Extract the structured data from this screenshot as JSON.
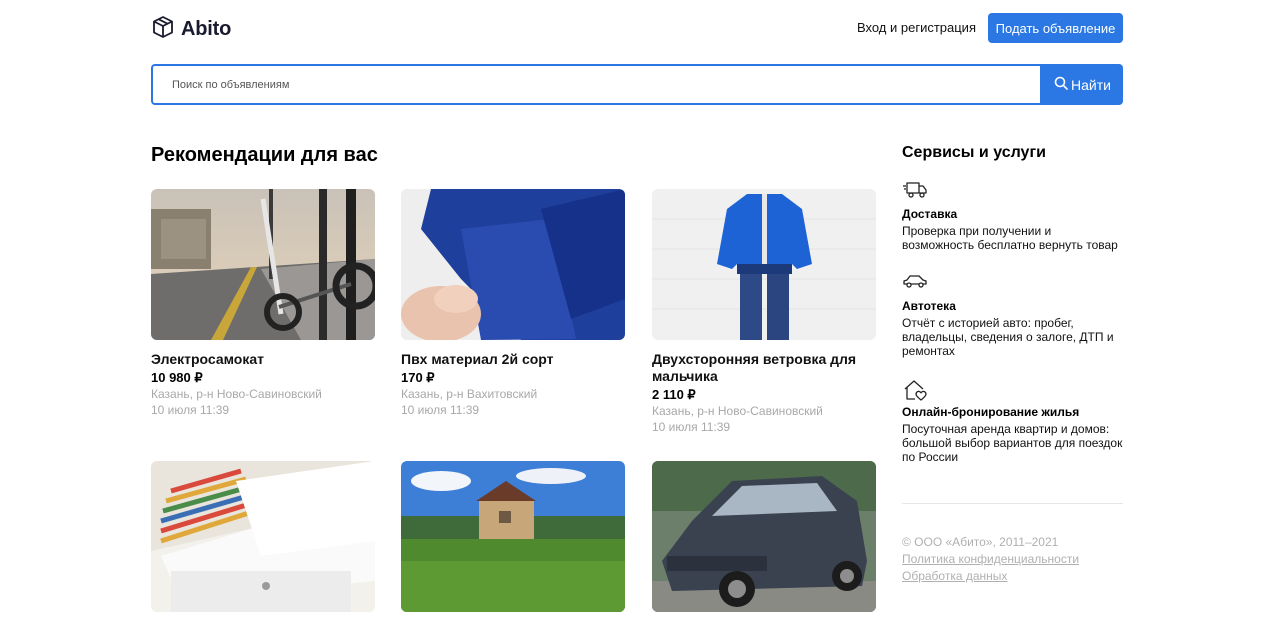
{
  "header": {
    "logo_text": "Abito",
    "login_label": "Вход и регистрация",
    "post_button_label": "Подать объявление"
  },
  "search": {
    "placeholder": "Поиск по объявлениям",
    "button_label": "Найти"
  },
  "recommendations": {
    "title": "Рекомендации для вас",
    "items": [
      {
        "title": "Электросамокат",
        "price": "10 980 ₽",
        "location": "Казань, р-н Ново-Савиновский",
        "date": "10 июля 11:39",
        "image": "electric-scooter-photo"
      },
      {
        "title": "Пвх материал 2й сорт",
        "price": "170 ₽",
        "location": "Казань, р-н Вахитовский",
        "date": "10 июля 11:39",
        "image": "pvc-material-photo"
      },
      {
        "title": "Двухсторонняя ветровка для мальчика",
        "price": "2 110 ₽",
        "location": "Казань, р-н Ново-Савиновский",
        "date": "10 июля 11:39",
        "image": "jacket-photo"
      },
      {
        "title": "",
        "price": "",
        "location": "",
        "date": "",
        "image": "bed-linen-photo"
      },
      {
        "title": "",
        "price": "",
        "location": "",
        "date": "",
        "image": "house-photo"
      },
      {
        "title": "",
        "price": "",
        "location": "",
        "date": "",
        "image": "car-photo"
      }
    ]
  },
  "services": {
    "title": "Сервисы и услуги",
    "items": [
      {
        "name": "Доставка",
        "description": "Проверка при получении и возможность бесплатно вернуть товар",
        "icon": "truck-icon"
      },
      {
        "name": "Автотека",
        "description": "Отчёт с историей авто: пробег, владельцы, сведения о залоге, ДТП и ремонтах",
        "icon": "car-icon"
      },
      {
        "name": "Онлайн-бронирование жилья",
        "description": "Посуточная аренда квартир и домов: большой выбор вариантов для поездок по России",
        "icon": "house-heart-icon"
      }
    ]
  },
  "footer": {
    "copyright": "© ООО «Абито», 2011–2021",
    "privacy_link": "Политика конфиденциальности",
    "data_link": "Обработка данных"
  },
  "colors": {
    "accent": "#2b78e4",
    "muted_text": "#a8a8a8"
  }
}
